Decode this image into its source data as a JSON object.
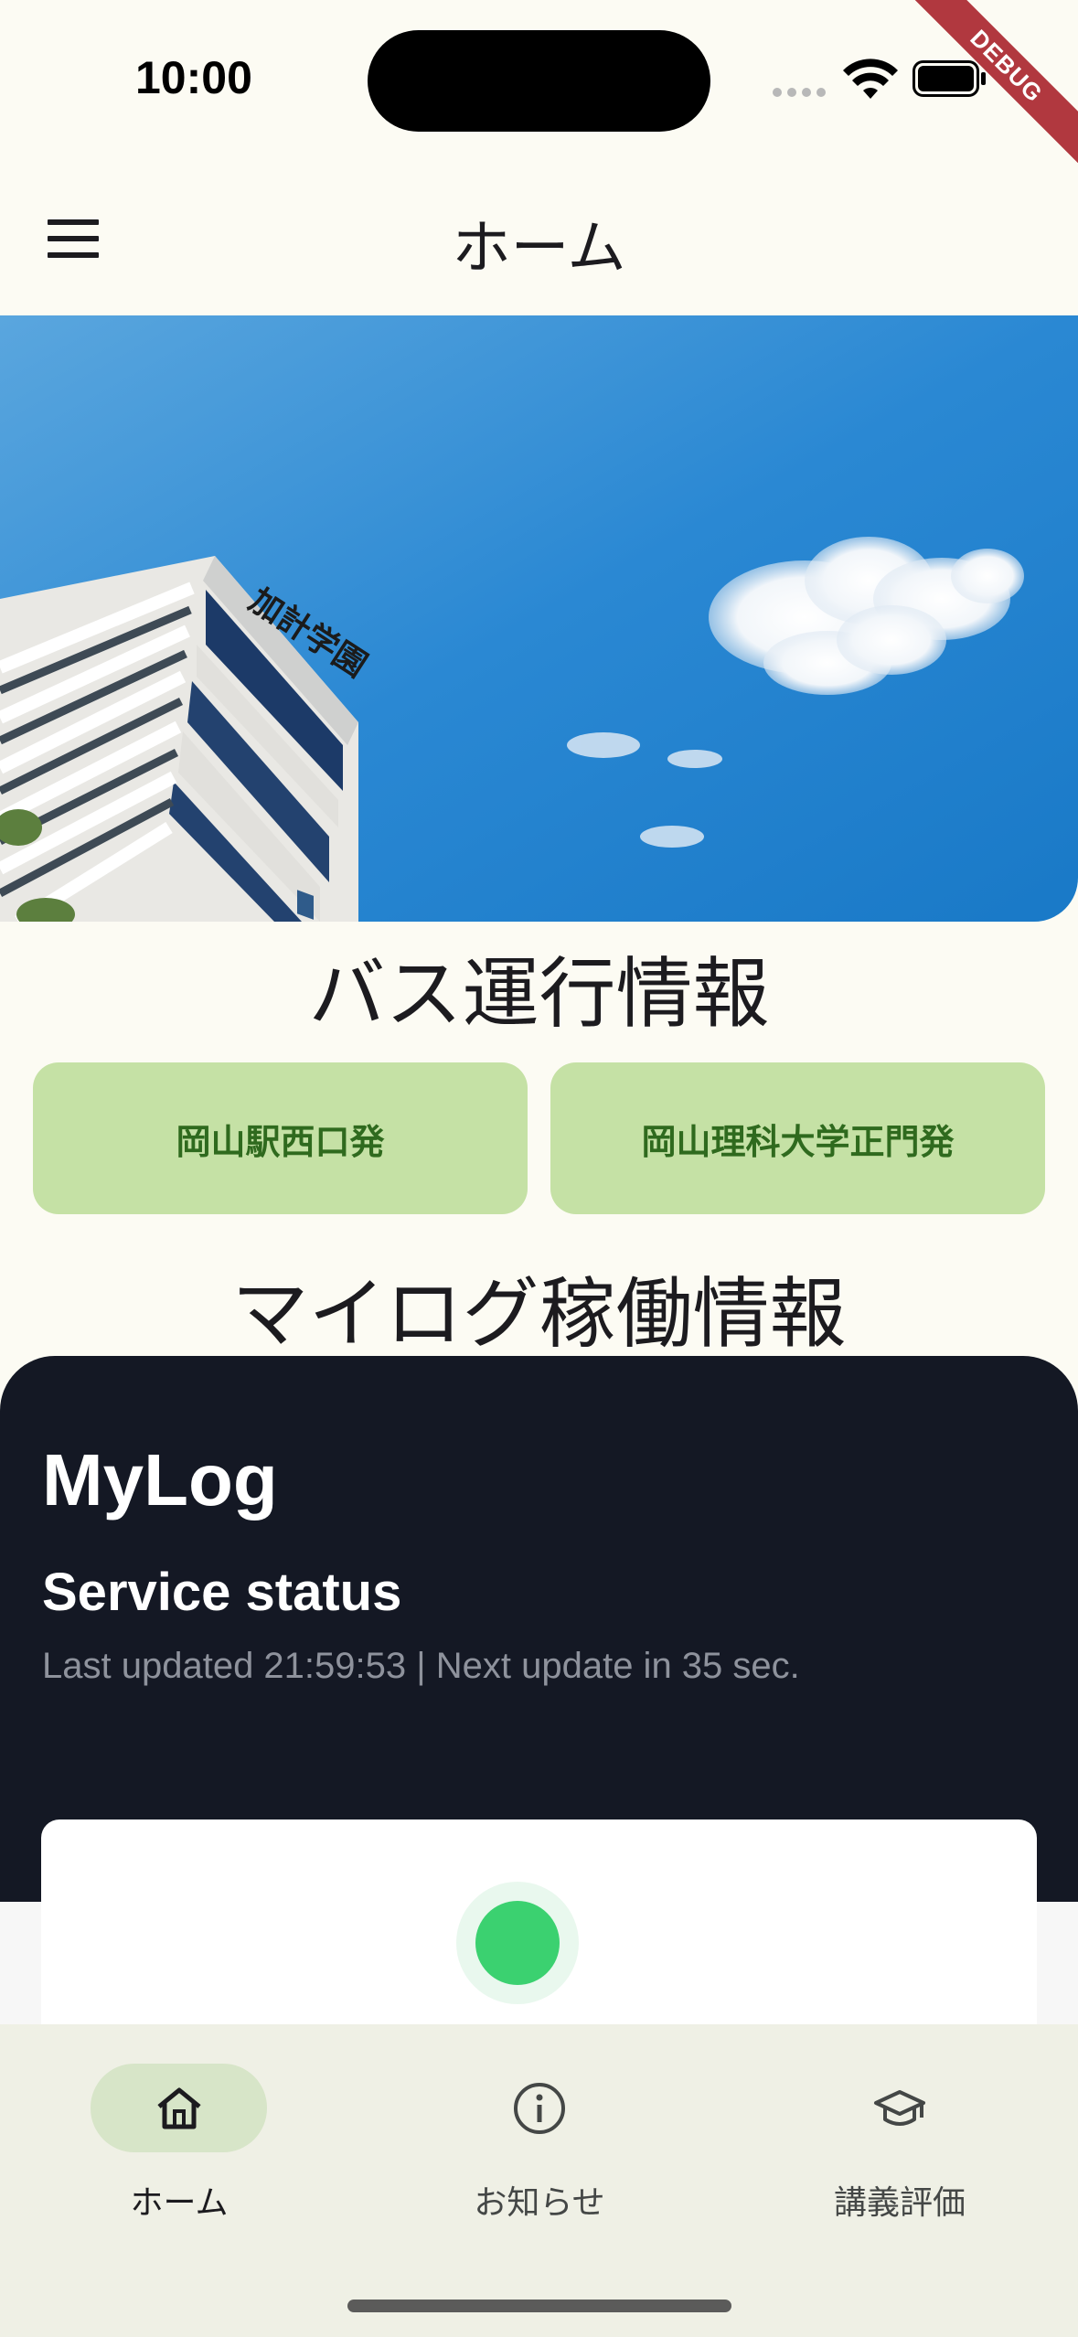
{
  "status_bar": {
    "time": "10:00",
    "debug_label": "DEBUG"
  },
  "app_bar": {
    "title": "ホーム",
    "menu_icon": "hamburger-menu-icon"
  },
  "hero": {
    "building_sign": "加計学園"
  },
  "bus": {
    "title": "バス運行情報",
    "buttons": [
      "岡山駅西口発",
      "岡山理科大学正門発"
    ]
  },
  "mylog": {
    "title": "マイログ稼働情報",
    "brand": "MyLog",
    "service_status": "Service status",
    "last_updated": "Last updated 21:59:53 | Next update in 35 sec.",
    "status_color": "#3bd170"
  },
  "nav": {
    "items": [
      {
        "label": "ホーム",
        "icon": "home-icon",
        "active": true
      },
      {
        "label": "お知らせ",
        "icon": "info-icon",
        "active": false
      },
      {
        "label": "講義評価",
        "icon": "graduation-cap-icon",
        "active": false
      }
    ]
  },
  "colors": {
    "background": "#fcfbf3",
    "bus_button": "#c5e1a5",
    "bus_button_text": "#2f6a1e",
    "mylog_panel": "#141824",
    "nav_active_pill": "#d7e5c8"
  }
}
